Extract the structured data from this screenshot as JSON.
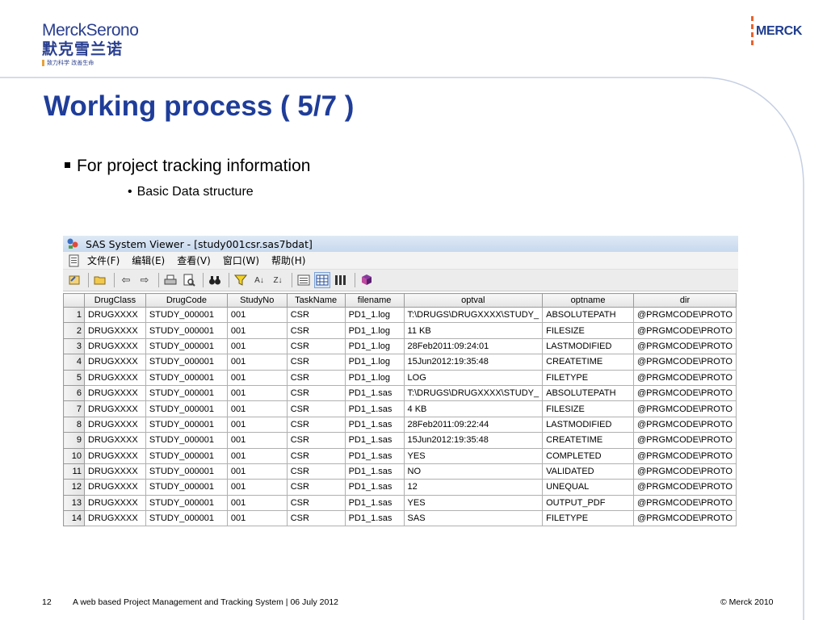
{
  "logos": {
    "merck_serono": {
      "brand": "MerckSerono",
      "chinese": "默克雪兰诺",
      "slogan": "致力科学 改善生命"
    },
    "merck": {
      "word": "MERCK"
    }
  },
  "slide": {
    "title": "Working process ( 5/7 )",
    "bullet_main": "For project tracking information",
    "bullet_sub": "Basic Data structure"
  },
  "viewer": {
    "window_title": "SAS System Viewer - [study001csr.sas7bdat]",
    "menu": [
      "文件(F)",
      "编辑(E)",
      "查看(V)",
      "窗口(W)",
      "帮助(H)"
    ],
    "toolbar_icons": [
      "open-file-icon",
      "folder-open-icon",
      "back-arrow-icon",
      "forward-arrow-icon",
      "print-icon",
      "print-preview-icon",
      "find-binoculars-icon",
      "filter-icon",
      "sort-ascending-icon",
      "sort-descending-icon",
      "form-view-icon",
      "table-view-icon",
      "column-view-icon",
      "book-icon"
    ],
    "columns": [
      "DrugClass",
      "DrugCode",
      "StudyNo",
      "TaskName",
      "filename",
      "optval",
      "optname",
      "dir"
    ],
    "rows": [
      [
        "1",
        "DRUGXXXX",
        "STUDY_000001",
        "001",
        "CSR",
        "PD1_1.log",
        "T:\\DRUGS\\DRUGXXXX\\STUDY_",
        "ABSOLUTEPATH",
        "@PRGMCODE\\PROTO"
      ],
      [
        "2",
        "DRUGXXXX",
        "STUDY_000001",
        "001",
        "CSR",
        "PD1_1.log",
        "11 KB",
        "FILESIZE",
        "@PRGMCODE\\PROTO"
      ],
      [
        "3",
        "DRUGXXXX",
        "STUDY_000001",
        "001",
        "CSR",
        "PD1_1.log",
        "28Feb2011:09:24:01",
        "LASTMODIFIED",
        "@PRGMCODE\\PROTO"
      ],
      [
        "4",
        "DRUGXXXX",
        "STUDY_000001",
        "001",
        "CSR",
        "PD1_1.log",
        "15Jun2012:19:35:48",
        "CREATETIME",
        "@PRGMCODE\\PROTO"
      ],
      [
        "5",
        "DRUGXXXX",
        "STUDY_000001",
        "001",
        "CSR",
        "PD1_1.log",
        "LOG",
        "FILETYPE",
        "@PRGMCODE\\PROTO"
      ],
      [
        "6",
        "DRUGXXXX",
        "STUDY_000001",
        "001",
        "CSR",
        "PD1_1.sas",
        "T:\\DRUGS\\DRUGXXXX\\STUDY_",
        "ABSOLUTEPATH",
        "@PRGMCODE\\PROTO"
      ],
      [
        "7",
        "DRUGXXXX",
        "STUDY_000001",
        "001",
        "CSR",
        "PD1_1.sas",
        "4 KB",
        "FILESIZE",
        "@PRGMCODE\\PROTO"
      ],
      [
        "8",
        "DRUGXXXX",
        "STUDY_000001",
        "001",
        "CSR",
        "PD1_1.sas",
        "28Feb2011:09:22:44",
        "LASTMODIFIED",
        "@PRGMCODE\\PROTO"
      ],
      [
        "9",
        "DRUGXXXX",
        "STUDY_000001",
        "001",
        "CSR",
        "PD1_1.sas",
        "15Jun2012:19:35:48",
        "CREATETIME",
        "@PRGMCODE\\PROTO"
      ],
      [
        "10",
        "DRUGXXXX",
        "STUDY_000001",
        "001",
        "CSR",
        "PD1_1.sas",
        "YES",
        "COMPLETED",
        "@PRGMCODE\\PROTO"
      ],
      [
        "11",
        "DRUGXXXX",
        "STUDY_000001",
        "001",
        "CSR",
        "PD1_1.sas",
        "NO",
        "VALIDATED",
        "@PRGMCODE\\PROTO"
      ],
      [
        "12",
        "DRUGXXXX",
        "STUDY_000001",
        "001",
        "CSR",
        "PD1_1.sas",
        "12",
        "UNEQUAL",
        "@PRGMCODE\\PROTO"
      ],
      [
        "13",
        "DRUGXXXX",
        "STUDY_000001",
        "001",
        "CSR",
        "PD1_1.sas",
        "YES",
        "OUTPUT_PDF",
        "@PRGMCODE\\PROTO"
      ],
      [
        "14",
        "DRUGXXXX",
        "STUDY_000001",
        "001",
        "CSR",
        "PD1_1.sas",
        "SAS",
        "FILETYPE",
        "@PRGMCODE\\PROTO"
      ]
    ]
  },
  "footer": {
    "page_number": "12",
    "text": "A web based Project Management and  Tracking System  |  06 July 2012",
    "copyright": "© Merck 2010"
  },
  "colors": {
    "title": "#1f3d99",
    "brand_blue": "#2a3f8f",
    "merck_orange": "#e8632b",
    "curve": "#c5cfe3"
  }
}
